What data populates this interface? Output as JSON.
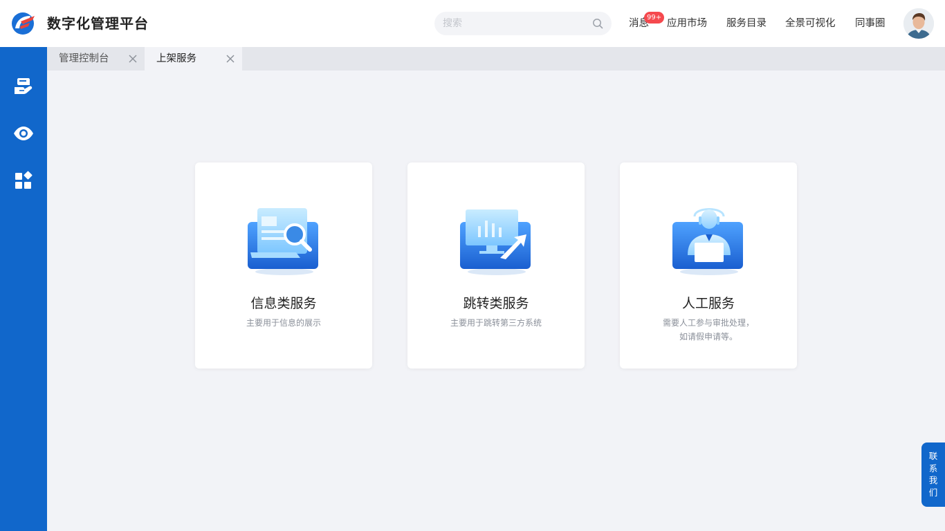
{
  "header": {
    "app_title": "数字化管理平台",
    "search_placeholder": "搜索",
    "nav": {
      "messages": "消息",
      "messages_badge": "99+",
      "app_market": "应用市场",
      "service_catalog": "服务目录",
      "panorama": "全景可视化",
      "colleagues": "同事圈"
    },
    "avatar_icon": "user-avatar"
  },
  "sidebar": {
    "items": [
      {
        "icon": "service-hand-icon"
      },
      {
        "icon": "eye-icon"
      },
      {
        "icon": "apps-grid-icon"
      }
    ]
  },
  "tabs": [
    {
      "label": "管理控制台",
      "active": false
    },
    {
      "label": "上架服务",
      "active": true
    }
  ],
  "cards": [
    {
      "title": "信息类服务",
      "desc": [
        "主要用于信息的展示"
      ],
      "icon": "document-search-icon"
    },
    {
      "title": "跳转类服务",
      "desc": [
        "主要用于跳转第三方系统"
      ],
      "icon": "monitor-redirect-icon"
    },
    {
      "title": "人工服务",
      "desc": [
        "需要人工参与审批处理，",
        "如请假申请等。"
      ],
      "icon": "customer-agent-icon"
    }
  ],
  "contact": {
    "chars": [
      "联",
      "系",
      "我",
      "们"
    ]
  },
  "colors": {
    "primary": "#1167cb",
    "badge": "#f5494e",
    "background": "#f2f3f7"
  }
}
